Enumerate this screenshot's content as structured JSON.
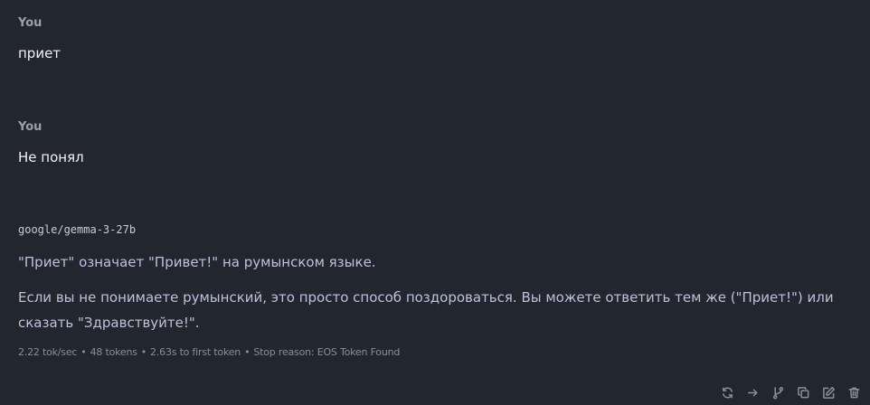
{
  "messages": [
    {
      "role": "user",
      "sender": "You",
      "text": "приет"
    },
    {
      "role": "user",
      "sender": "You",
      "text": "Не понял"
    },
    {
      "role": "assistant",
      "sender": "google/gemma-3-27b",
      "paragraphs": [
        "\"Приет\" означает \"Привет!\" на румынском языке.",
        "Если вы не понимаете румынский, это просто способ поздороваться. Вы можете ответить тем же (\"Приет!\") или сказать \"Здравствуйте!\"."
      ]
    }
  ],
  "stats": {
    "speed": "2.22 tok/sec",
    "tokens": "48 tokens",
    "first_token": "2.63s to first token",
    "stop_reason": "Stop reason: EOS Token Found"
  },
  "actions": [
    {
      "icon": "regenerate-icon"
    },
    {
      "icon": "continue-arrow-icon"
    },
    {
      "icon": "branch-icon"
    },
    {
      "icon": "copy-icon"
    },
    {
      "icon": "edit-icon"
    },
    {
      "icon": "trash-icon"
    }
  ],
  "colors": {
    "background": "#22262f",
    "assistant_text": "#c3bedb",
    "muted": "#888e99"
  }
}
